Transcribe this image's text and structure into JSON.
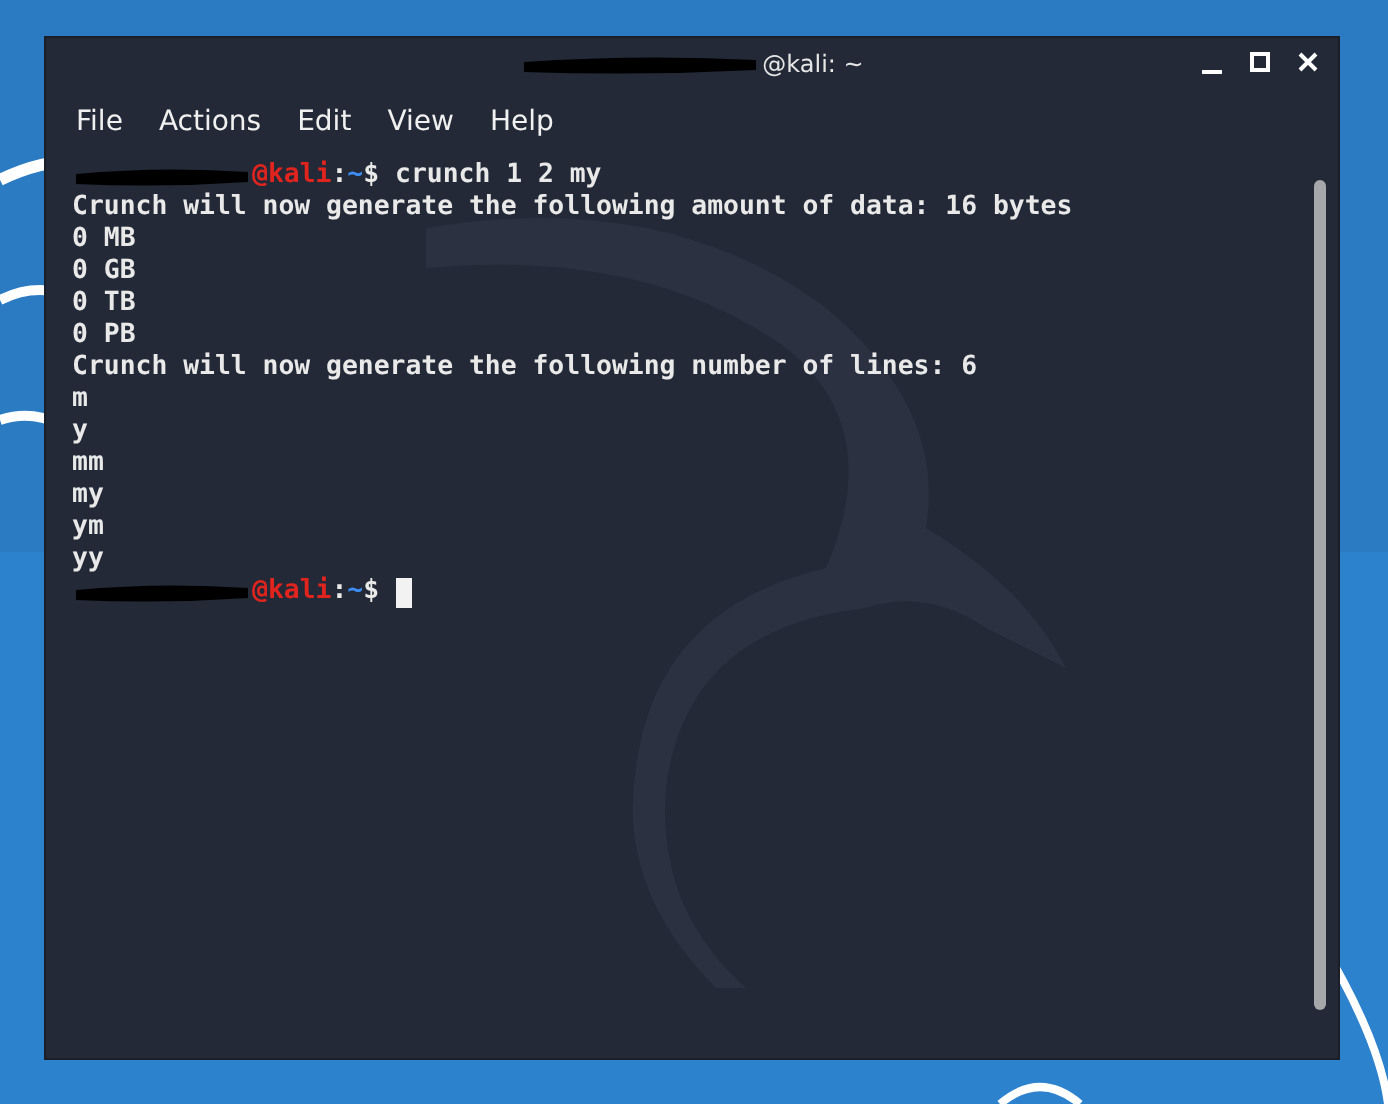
{
  "window": {
    "title": "@kali: ~"
  },
  "menu": [
    {
      "label": "File"
    },
    {
      "label": "Actions"
    },
    {
      "label": "Edit"
    },
    {
      "label": "View"
    },
    {
      "label": "Help"
    }
  ],
  "terminal": {
    "lines": [
      {
        "kind": "prompt",
        "host": "@kali",
        "sep": ":",
        "path": "~",
        "symbol": "$",
        "command": "crunch 1 2 my",
        "cursor": false
      },
      {
        "kind": "output",
        "text": "Crunch will now generate the following amount of data: 16 bytes"
      },
      {
        "kind": "output",
        "text": "0 MB"
      },
      {
        "kind": "output",
        "text": "0 GB"
      },
      {
        "kind": "output",
        "text": "0 TB"
      },
      {
        "kind": "output",
        "text": "0 PB"
      },
      {
        "kind": "output",
        "text": "Crunch will now generate the following number of lines: 6"
      },
      {
        "kind": "output",
        "text": "m"
      },
      {
        "kind": "output",
        "text": "y"
      },
      {
        "kind": "output",
        "text": "mm"
      },
      {
        "kind": "output",
        "text": "my"
      },
      {
        "kind": "output",
        "text": "ym"
      },
      {
        "kind": "output",
        "text": "yy"
      },
      {
        "kind": "prompt",
        "host": "@kali",
        "sep": ":",
        "path": "~",
        "symbol": "$",
        "cursor": true
      }
    ]
  }
}
